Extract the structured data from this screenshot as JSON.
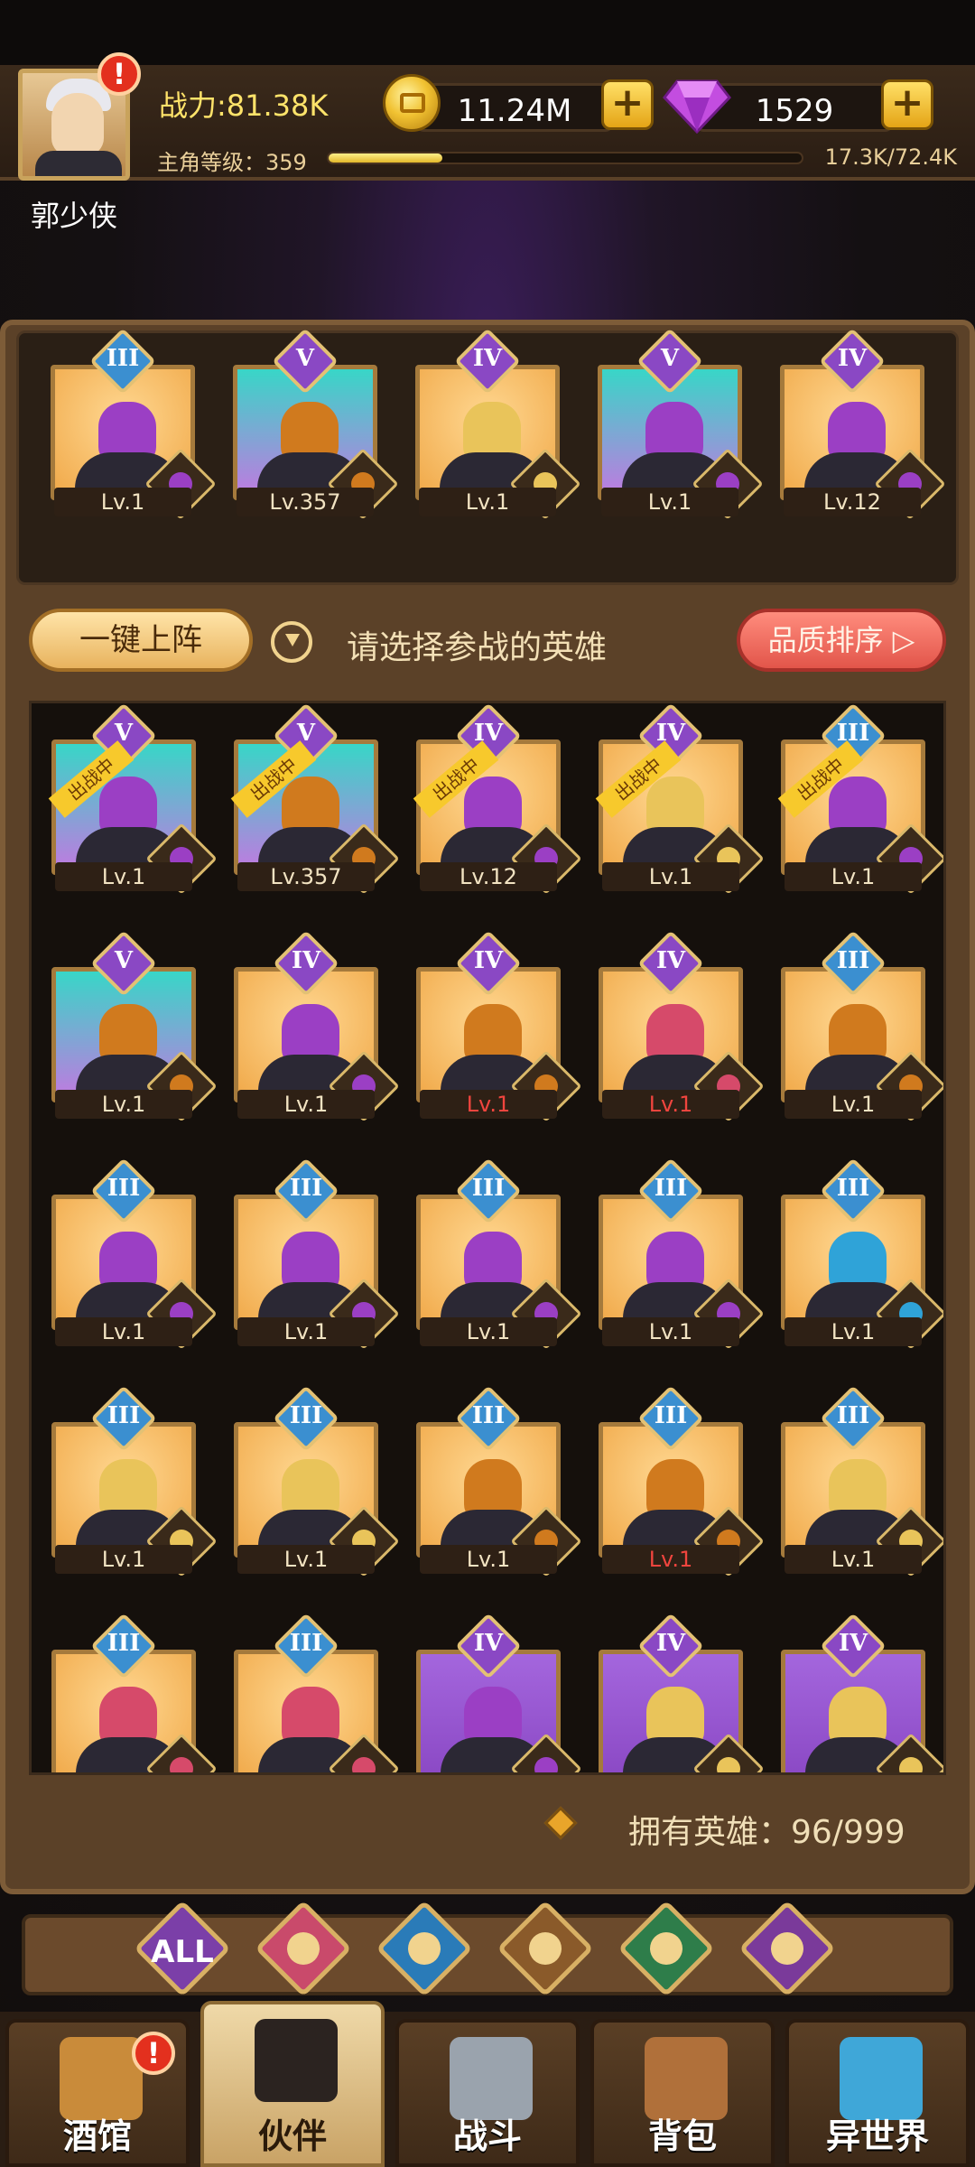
{
  "player": {
    "name": "郭少侠",
    "power": "战力:81.38K",
    "level_label": "主角等级：359",
    "xp_text": "17.3K/72.4K",
    "xp_fraction": 0.24
  },
  "currency": {
    "gold": "11.24M",
    "gems": "1529"
  },
  "lineup": [
    {
      "rank": "III",
      "level": "Lv.1",
      "bg": "#f6b763",
      "faction": "demon"
    },
    {
      "rank": "V",
      "level": "Lv.357",
      "bg": "#38d6c7",
      "faction": "lion"
    },
    {
      "rank": "IV",
      "level": "Lv.1",
      "bg": "#f6b763",
      "faction": "elf"
    },
    {
      "rank": "V",
      "level": "Lv.1",
      "bg": "#38d6c7",
      "faction": "demon"
    },
    {
      "rank": "IV",
      "level": "Lv.12",
      "bg": "#f6b763",
      "faction": "demon"
    }
  ],
  "actions": {
    "one_click": "一键上阵",
    "hint": "请选择参战的英雄",
    "sort": "品质排序 ▷"
  },
  "deployed_label": "出战中",
  "heroes": [
    {
      "rank": "V",
      "level": "Lv.1",
      "bg": "#38d6c7",
      "faction": "demon",
      "deployed": true,
      "red": false
    },
    {
      "rank": "V",
      "level": "Lv.357",
      "bg": "#38d6c7",
      "faction": "lion",
      "deployed": true,
      "red": false
    },
    {
      "rank": "IV",
      "level": "Lv.12",
      "bg": "#f6b763",
      "faction": "demon",
      "deployed": true,
      "red": false
    },
    {
      "rank": "IV",
      "level": "Lv.1",
      "bg": "#f6b763",
      "faction": "elf",
      "deployed": true,
      "red": false
    },
    {
      "rank": "III",
      "level": "Lv.1",
      "bg": "#f6b763",
      "faction": "demon",
      "deployed": true,
      "red": false
    },
    {
      "rank": "V",
      "level": "Lv.1",
      "bg": "#38d6c7",
      "faction": "lion",
      "deployed": false,
      "red": false
    },
    {
      "rank": "IV",
      "level": "Lv.1",
      "bg": "#f6b763",
      "faction": "demon",
      "deployed": false,
      "red": false
    },
    {
      "rank": "IV",
      "level": "Lv.1",
      "bg": "#f6b763",
      "faction": "lion",
      "deployed": false,
      "red": true
    },
    {
      "rank": "IV",
      "level": "Lv.1",
      "bg": "#f6b763",
      "faction": "holy",
      "deployed": false,
      "red": true
    },
    {
      "rank": "III",
      "level": "Lv.1",
      "bg": "#f6b763",
      "faction": "lion",
      "deployed": false,
      "red": false
    },
    {
      "rank": "III",
      "level": "Lv.1",
      "bg": "#f6b763",
      "faction": "demon",
      "deployed": false,
      "red": false
    },
    {
      "rank": "III",
      "level": "Lv.1",
      "bg": "#f6b763",
      "faction": "demon",
      "deployed": false,
      "red": false
    },
    {
      "rank": "III",
      "level": "Lv.1",
      "bg": "#f6b763",
      "faction": "demon",
      "deployed": false,
      "red": false
    },
    {
      "rank": "III",
      "level": "Lv.1",
      "bg": "#f6b763",
      "faction": "demon",
      "deployed": false,
      "red": false
    },
    {
      "rank": "III",
      "level": "Lv.1",
      "bg": "#f6b763",
      "faction": "sea",
      "deployed": false,
      "red": false
    },
    {
      "rank": "III",
      "level": "Lv.1",
      "bg": "#f6b763",
      "faction": "elf",
      "deployed": false,
      "red": false
    },
    {
      "rank": "III",
      "level": "Lv.1",
      "bg": "#f6b763",
      "faction": "elf",
      "deployed": false,
      "red": false
    },
    {
      "rank": "III",
      "level": "Lv.1",
      "bg": "#f6b763",
      "faction": "lion",
      "deployed": false,
      "red": false
    },
    {
      "rank": "III",
      "level": "Lv.1",
      "bg": "#f6b763",
      "faction": "lion",
      "deployed": false,
      "red": true
    },
    {
      "rank": "III",
      "level": "Lv.1",
      "bg": "#f6b763",
      "faction": "elf",
      "deployed": false,
      "red": false
    },
    {
      "rank": "III",
      "level": "",
      "bg": "#f6b763",
      "faction": "holy",
      "deployed": false,
      "red": false
    },
    {
      "rank": "III",
      "level": "",
      "bg": "#f6b763",
      "faction": "holy",
      "deployed": false,
      "red": false
    },
    {
      "rank": "IV",
      "level": "",
      "bg": "#9b59d6",
      "faction": "demon",
      "deployed": false,
      "red": false
    },
    {
      "rank": "IV",
      "level": "",
      "bg": "#9b59d6",
      "faction": "elf",
      "deployed": false,
      "red": false
    },
    {
      "rank": "IV",
      "level": "",
      "bg": "#9b59d6",
      "faction": "elf",
      "deployed": false,
      "red": false
    }
  ],
  "owned": "拥有英雄：96/999",
  "filters": [
    {
      "label": "ALL",
      "icon": "all-icon",
      "color": "#7b3fa8"
    },
    {
      "label": "",
      "icon": "holy-faction-icon",
      "color": "#c94a6b"
    },
    {
      "label": "",
      "icon": "sea-faction-icon",
      "color": "#2a7bb8"
    },
    {
      "label": "",
      "icon": "lion-faction-icon",
      "color": "#8a5a2a"
    },
    {
      "label": "",
      "icon": "elf-faction-icon",
      "color": "#2e7d4a"
    },
    {
      "label": "",
      "icon": "demon-faction-icon",
      "color": "#7a3a9a"
    }
  ],
  "nav": [
    {
      "label": "酒馆",
      "icon": "tavern-icon",
      "active": false,
      "alert": true
    },
    {
      "label": "伙伴",
      "icon": "partner-icon",
      "active": true,
      "alert": false
    },
    {
      "label": "战斗",
      "icon": "battle-icon",
      "active": false,
      "alert": false
    },
    {
      "label": "背包",
      "icon": "backpack-icon",
      "active": false,
      "alert": false
    },
    {
      "label": "异世界",
      "icon": "portal-icon",
      "active": false,
      "alert": false
    }
  ],
  "colors": {
    "faction_demon": "#9b3fc4",
    "faction_lion": "#d07a1e",
    "faction_elf": "#e9c45a",
    "faction_holy": "#d64a6a",
    "faction_sea": "#2fa3d8",
    "rank_III": "#3b8fd0",
    "rank_IV": "#8a48c4",
    "rank_V": "#8a48c4"
  }
}
